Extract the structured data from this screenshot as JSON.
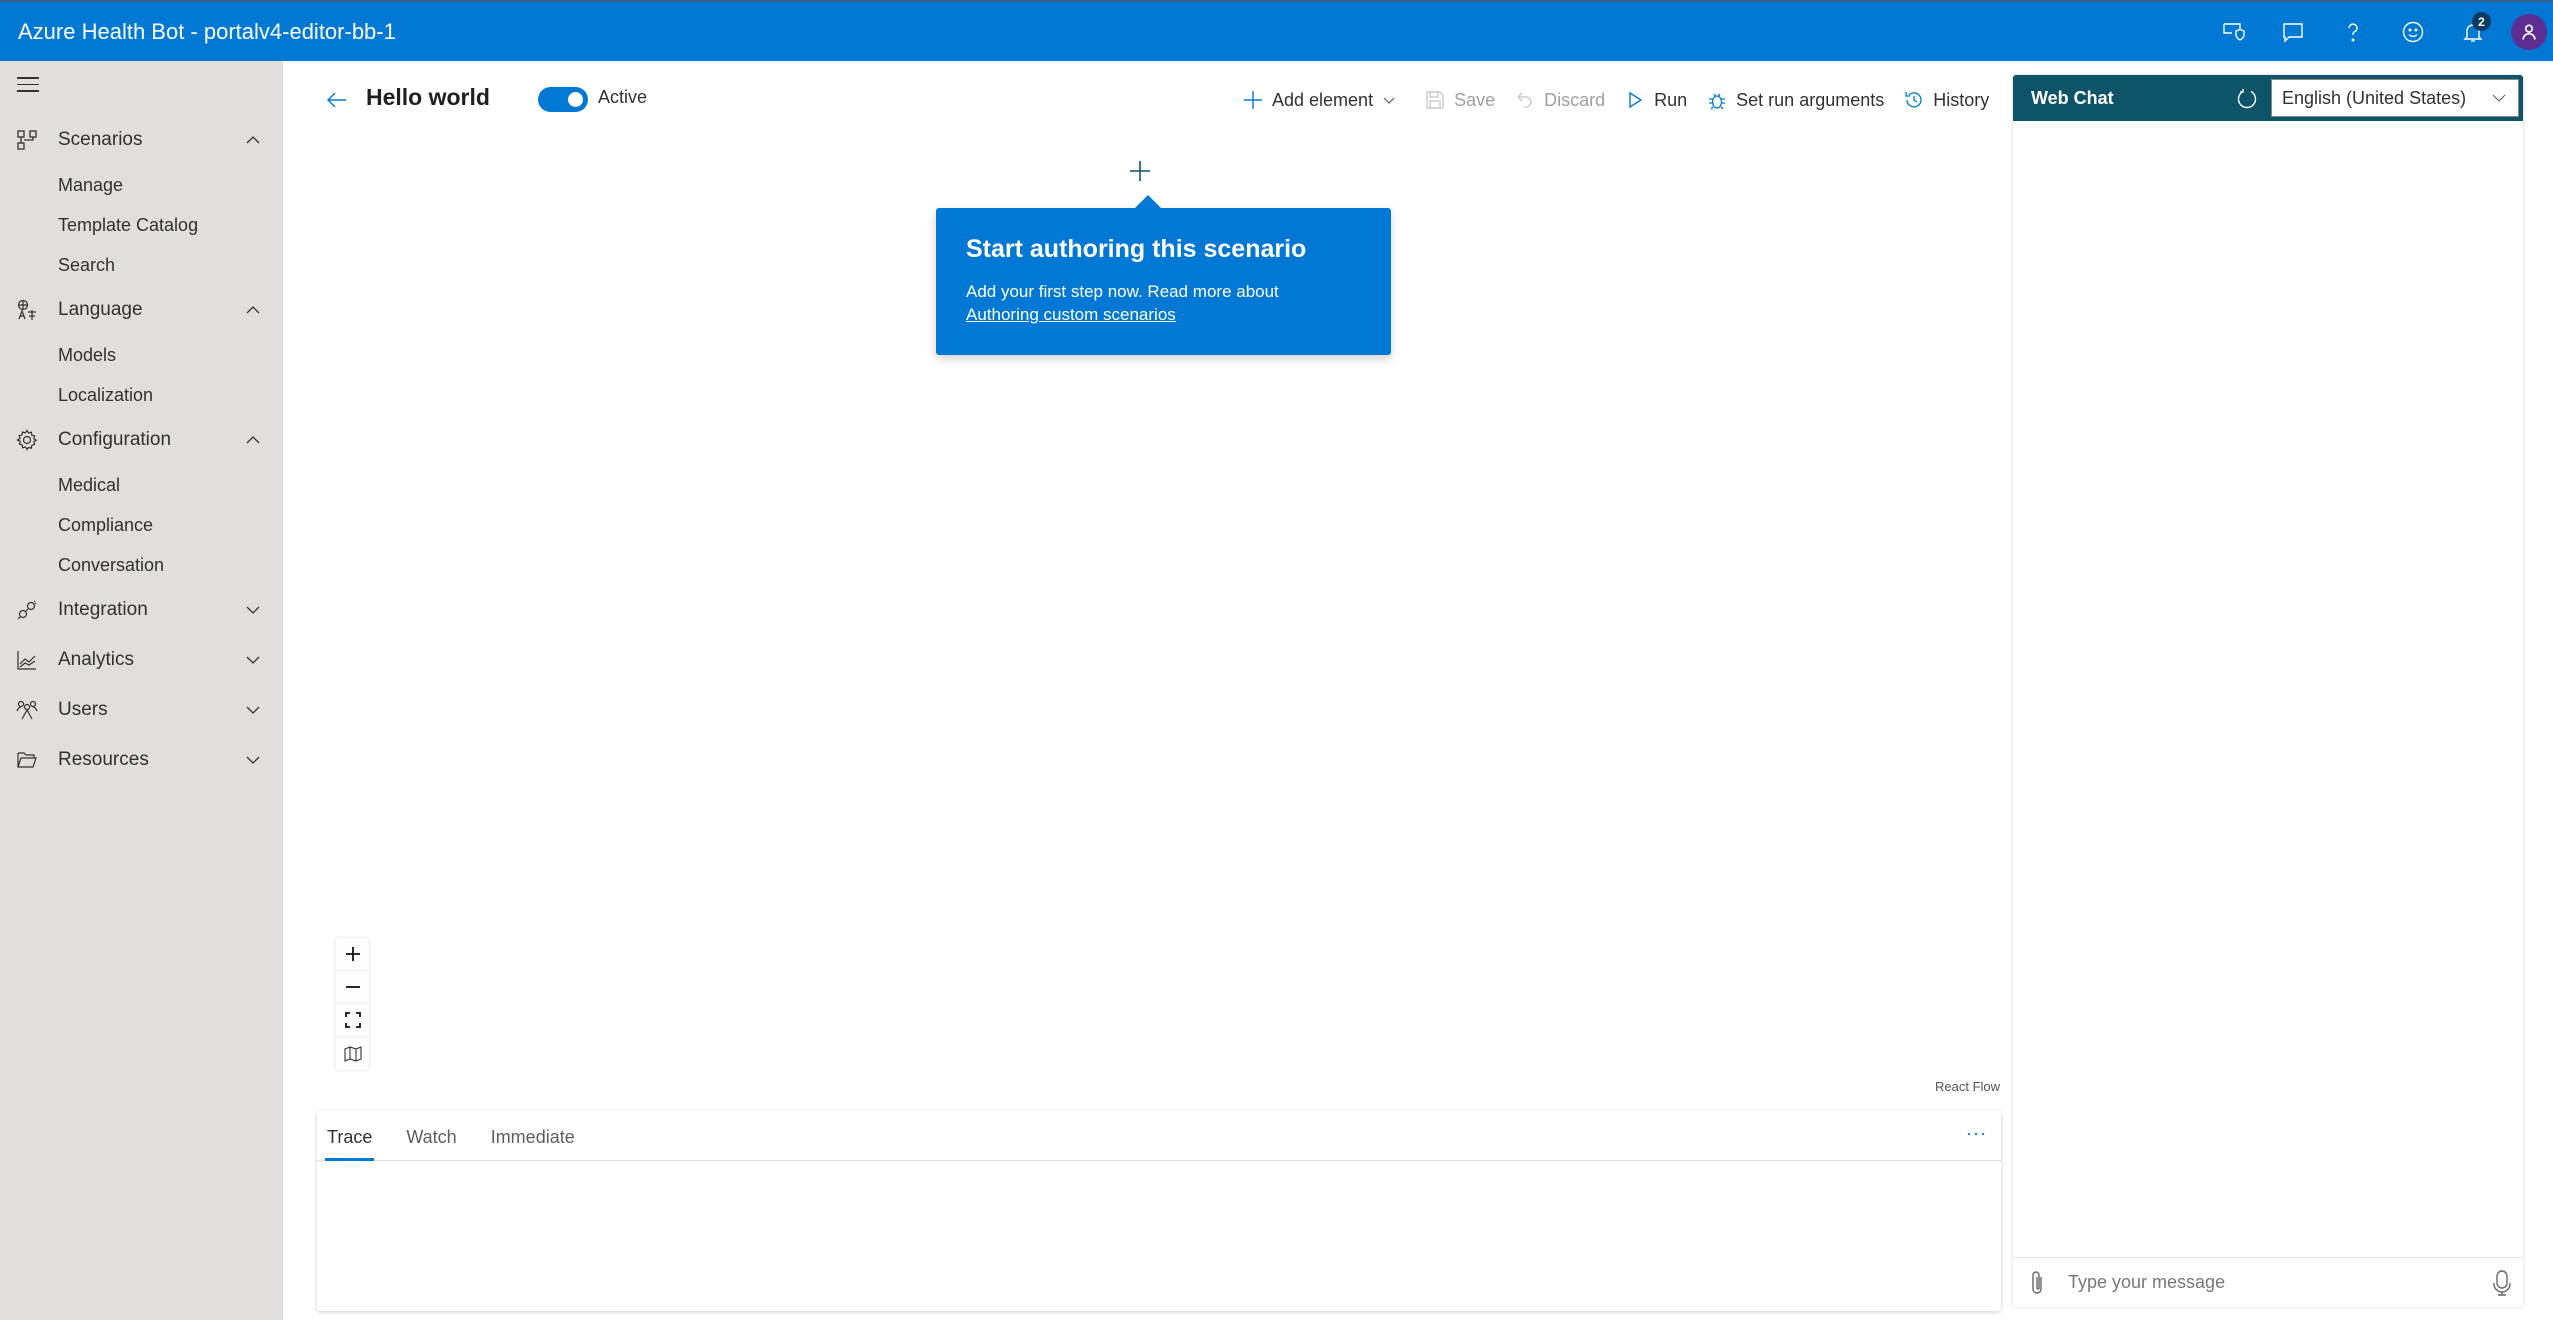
{
  "app": {
    "title": "Azure Health Bot - portalv4-editor-bb-1",
    "notifications_count": "2",
    "header_icons": [
      "shield-chat-icon",
      "feedback-icon",
      "help-icon",
      "smiley-icon",
      "bell-icon"
    ],
    "brand_color": "#0078d4"
  },
  "sidebar": {
    "groups": [
      {
        "label": "Scenarios",
        "icon": "scenarios-icon",
        "expanded": true,
        "items": [
          "Manage",
          "Template Catalog",
          "Search"
        ]
      },
      {
        "label": "Language",
        "icon": "language-icon",
        "expanded": true,
        "items": [
          "Models",
          "Localization"
        ]
      },
      {
        "label": "Configuration",
        "icon": "gear-icon",
        "expanded": true,
        "items": [
          "Medical",
          "Compliance",
          "Conversation"
        ]
      },
      {
        "label": "Integration",
        "icon": "plug-icon",
        "expanded": false,
        "items": []
      },
      {
        "label": "Analytics",
        "icon": "analytics-icon",
        "expanded": false,
        "items": []
      },
      {
        "label": "Users",
        "icon": "users-icon",
        "expanded": false,
        "items": []
      },
      {
        "label": "Resources",
        "icon": "folder-icon",
        "expanded": false,
        "items": []
      }
    ]
  },
  "editor": {
    "scenario_title": "Hello world",
    "active_label": "Active",
    "active": true,
    "commands": {
      "add_element": "Add element",
      "save": "Save",
      "discard": "Discard",
      "run": "Run",
      "set_run_arguments": "Set run arguments",
      "history": "History"
    },
    "teaching_bubble": {
      "title": "Start authoring this scenario",
      "body": "Add your first step now. Read more about",
      "link": "Authoring custom scenarios"
    },
    "attribution": "React Flow",
    "debug_tabs": [
      "Trace",
      "Watch",
      "Immediate"
    ],
    "active_debug_tab": "Trace",
    "more_label": "···"
  },
  "webchat": {
    "title": "Web Chat",
    "language": "English (United States)",
    "input_placeholder": "Type your message",
    "header_color": "#0e5469"
  }
}
